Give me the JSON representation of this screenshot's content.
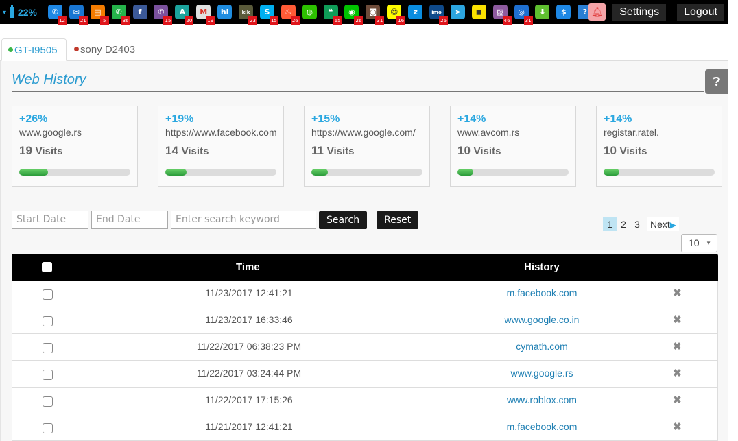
{
  "topbar": {
    "battery_percent": "22%",
    "apps": [
      {
        "icon": "phone-icon",
        "glyph": "✆",
        "color": "#1e88e5",
        "badge": "12"
      },
      {
        "icon": "email-icon",
        "glyph": "✉",
        "color": "#1976d2",
        "badge": "21"
      },
      {
        "icon": "sms-icon",
        "glyph": "▤",
        "color": "#f57c00",
        "badge": "5"
      },
      {
        "icon": "whatsapp-icon",
        "glyph": "✆",
        "color": "#25b34a",
        "badge": "36"
      },
      {
        "icon": "facebook-icon",
        "glyph": "f",
        "color": "#3b5998",
        "badge": ""
      },
      {
        "icon": "viber-icon",
        "glyph": "✆",
        "color": "#7b519d",
        "badge": "15"
      },
      {
        "icon": "hangouts-a-icon",
        "glyph": "A",
        "color": "#1ba39c",
        "badge": "20"
      },
      {
        "icon": "gmail-icon",
        "glyph": "M",
        "color": "#e0e0e0",
        "badge": "19"
      },
      {
        "icon": "hike-icon",
        "glyph": "hi",
        "color": "#1f8de0",
        "badge": ""
      },
      {
        "icon": "kik-icon",
        "glyph": "kik",
        "color": "#5a5a3a",
        "badge": "23"
      },
      {
        "icon": "skype-icon",
        "glyph": "S",
        "color": "#00aff0",
        "badge": "15"
      },
      {
        "icon": "tinder-icon",
        "glyph": "♨",
        "color": "#ff5b36",
        "badge": "26"
      },
      {
        "icon": "wechat-icon",
        "glyph": "◍",
        "color": "#2dc100",
        "badge": ""
      },
      {
        "icon": "hangouts-icon",
        "glyph": "❝",
        "color": "#0f9d58",
        "badge": "65"
      },
      {
        "icon": "line-icon",
        "glyph": "◉",
        "color": "#00c300",
        "badge": "26"
      },
      {
        "icon": "instagram-icon",
        "glyph": "◙",
        "color": "#6d4b3a",
        "badge": "31"
      },
      {
        "icon": "snapchat-icon",
        "glyph": "☺",
        "color": "#fffc00",
        "badge": "16"
      },
      {
        "icon": "zalo-icon",
        "glyph": "z",
        "color": "#0a8de0",
        "badge": ""
      },
      {
        "icon": "imo-icon",
        "glyph": "imo",
        "color": "#0f4a8a",
        "badge": "26"
      },
      {
        "icon": "telegram-icon",
        "glyph": "➤",
        "color": "#2ca5e0",
        "badge": ""
      },
      {
        "icon": "kakaotalk-icon",
        "glyph": "◼",
        "color": "#f9e000",
        "badge": ""
      },
      {
        "icon": "gallery-icon",
        "glyph": "▨",
        "color": "#8e5a9e",
        "badge": "46"
      },
      {
        "icon": "browser-globe-icon",
        "glyph": "◎",
        "color": "#1e6fd0",
        "badge": "31"
      },
      {
        "icon": "download-arrow-icon",
        "glyph": "⬇",
        "color": "#5fbf2f",
        "badge": ""
      },
      {
        "icon": "dollar-icon",
        "glyph": "$",
        "color": "#1e88e5",
        "badge": ""
      },
      {
        "icon": "help-question-icon",
        "glyph": "?",
        "color": "#2a7fd4",
        "badge": ""
      }
    ],
    "settings_label": "Settings",
    "logout_label": "Logout"
  },
  "tabs": [
    {
      "label": "GT-I9505",
      "status_color": "#3cb64a"
    },
    {
      "label": "sony D2403",
      "status_color": "#c0392b"
    }
  ],
  "panel": {
    "title": "Web History"
  },
  "stats": [
    {
      "pct": "+26%",
      "url": "www.google.rs",
      "count": "19",
      "visits_label": "Visits",
      "bar_fraction": 0.26
    },
    {
      "pct": "+19%",
      "url": "https://www.facebook.com",
      "count": "14",
      "visits_label": "Visits",
      "bar_fraction": 0.19
    },
    {
      "pct": "+15%",
      "url": "https://www.google.com/",
      "count": "11",
      "visits_label": "Visits",
      "bar_fraction": 0.15
    },
    {
      "pct": "+14%",
      "url": "www.avcom.rs",
      "count": "10",
      "visits_label": "Visits",
      "bar_fraction": 0.14
    },
    {
      "pct": "+14%",
      "url": "registar.ratel.",
      "count": "10",
      "visits_label": "Visits",
      "bar_fraction": 0.14
    }
  ],
  "filters": {
    "start_date_placeholder": "Start Date",
    "end_date_placeholder": "End Date",
    "keyword_placeholder": "Enter search keyword",
    "search_label": "Search",
    "reset_label": "Reset"
  },
  "pagination": {
    "pages": [
      "1",
      "2",
      "3"
    ],
    "active": "1",
    "next_label": "Next",
    "per_page": "10"
  },
  "table": {
    "headers": {
      "time": "Time",
      "history": "History"
    },
    "rows": [
      {
        "time": "11/23/2017 12:41:21",
        "history": "m.facebook.com"
      },
      {
        "time": "11/23/2017 16:33:46",
        "history": "www.google.co.in"
      },
      {
        "time": "11/22/2017 06:38:23 PM",
        "history": "cymath.com"
      },
      {
        "time": "11/22/2017 03:24:44 PM",
        "history": "www.google.rs"
      },
      {
        "time": "11/22/2017 17:15:26",
        "history": "www.roblox.com"
      },
      {
        "time": "11/21/2017 12:41:21",
        "history": "m.facebook.com"
      }
    ]
  }
}
